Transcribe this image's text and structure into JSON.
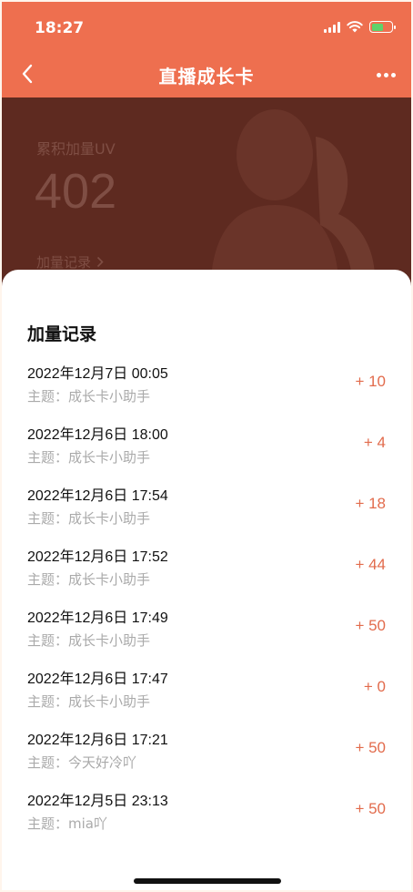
{
  "status_bar": {
    "time": "18:27"
  },
  "nav": {
    "title": "直播成长卡"
  },
  "card": {
    "label": "累积加量UV",
    "value": "402",
    "link_label": "加量记录"
  },
  "sheet": {
    "title": "加量记录",
    "records": [
      {
        "date": "2022年12月7日 00:05",
        "topic": "主题：成长卡小助手",
        "amount": "+ 10"
      },
      {
        "date": "2022年12月6日 18:00",
        "topic": "主题：成长卡小助手",
        "amount": "+ 4"
      },
      {
        "date": "2022年12月6日 17:54",
        "topic": "主题：成长卡小助手",
        "amount": "+ 18"
      },
      {
        "date": "2022年12月6日 17:52",
        "topic": "主题：成长卡小助手",
        "amount": "+ 44"
      },
      {
        "date": "2022年12月6日 17:49",
        "topic": "主题：成长卡小助手",
        "amount": "+ 50"
      },
      {
        "date": "2022年12月6日 17:47",
        "topic": "主题：成长卡小助手",
        "amount": "+ 0"
      },
      {
        "date": "2022年12月6日 17:21",
        "topic": "主题：今天好冷吖",
        "amount": "+ 50"
      },
      {
        "date": "2022年12月5日 23:13",
        "topic": "主题：mia吖",
        "amount": "+ 50"
      }
    ]
  },
  "colors": {
    "brand": "#ee6f4f",
    "card_dim": "#5e2a20",
    "amount": "#e26b4c",
    "muted_text": "#aaaaaa"
  },
  "icons": [
    "back-arrow-icon",
    "more-dots-icon",
    "signal-icon",
    "wifi-icon",
    "battery-icon",
    "chevron-right-icon",
    "person-silhouette-icon"
  ]
}
